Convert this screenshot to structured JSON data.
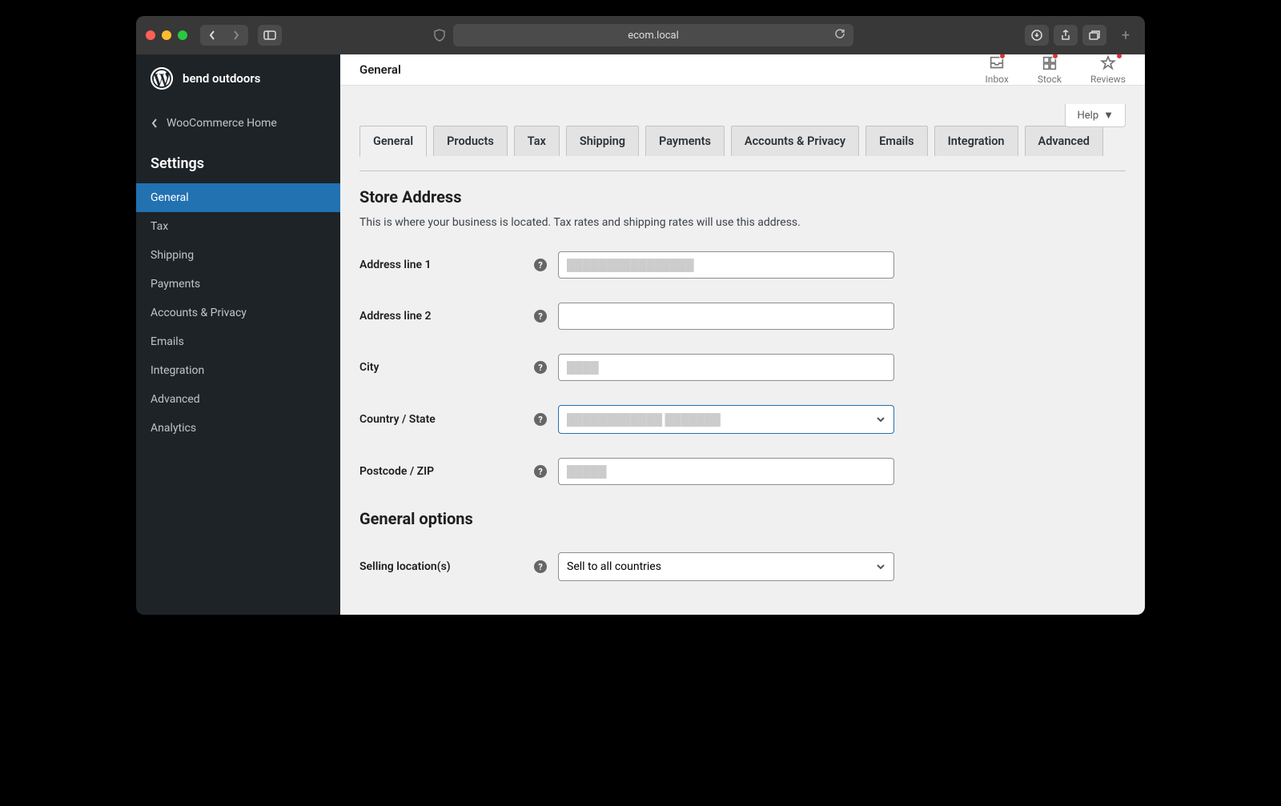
{
  "browser": {
    "url": "ecom.local"
  },
  "site": {
    "name": "bend outdoors"
  },
  "back_link": "WooCommerce Home",
  "settings_label": "Settings",
  "sidebar": {
    "items": [
      {
        "label": "General",
        "active": true
      },
      {
        "label": "Tax"
      },
      {
        "label": "Shipping"
      },
      {
        "label": "Payments"
      },
      {
        "label": "Accounts & Privacy"
      },
      {
        "label": "Emails"
      },
      {
        "label": "Integration"
      },
      {
        "label": "Advanced"
      },
      {
        "label": "Analytics"
      }
    ]
  },
  "topbar": {
    "title": "General",
    "inbox": "Inbox",
    "stock": "Stock",
    "reviews": "Reviews",
    "help": "Help"
  },
  "tabs": [
    {
      "label": "General",
      "active": true
    },
    {
      "label": "Products"
    },
    {
      "label": "Tax"
    },
    {
      "label": "Shipping"
    },
    {
      "label": "Payments"
    },
    {
      "label": "Accounts & Privacy"
    },
    {
      "label": "Emails"
    },
    {
      "label": "Integration"
    },
    {
      "label": "Advanced"
    }
  ],
  "sections": {
    "store_address": {
      "heading": "Store Address",
      "description": "This is where your business is located. Tax rates and shipping rates will use this address.",
      "fields": {
        "address1": {
          "label": "Address line 1",
          "value": "████████████████"
        },
        "address2": {
          "label": "Address line 2",
          "value": ""
        },
        "city": {
          "label": "City",
          "value": "████"
        },
        "country": {
          "label": "Country / State",
          "value": "████████████  ███████"
        },
        "postcode": {
          "label": "Postcode / ZIP",
          "value": "█████"
        }
      }
    },
    "general_options": {
      "heading": "General options",
      "fields": {
        "selling_locations": {
          "label": "Selling location(s)",
          "value": "Sell to all countries"
        }
      }
    }
  }
}
